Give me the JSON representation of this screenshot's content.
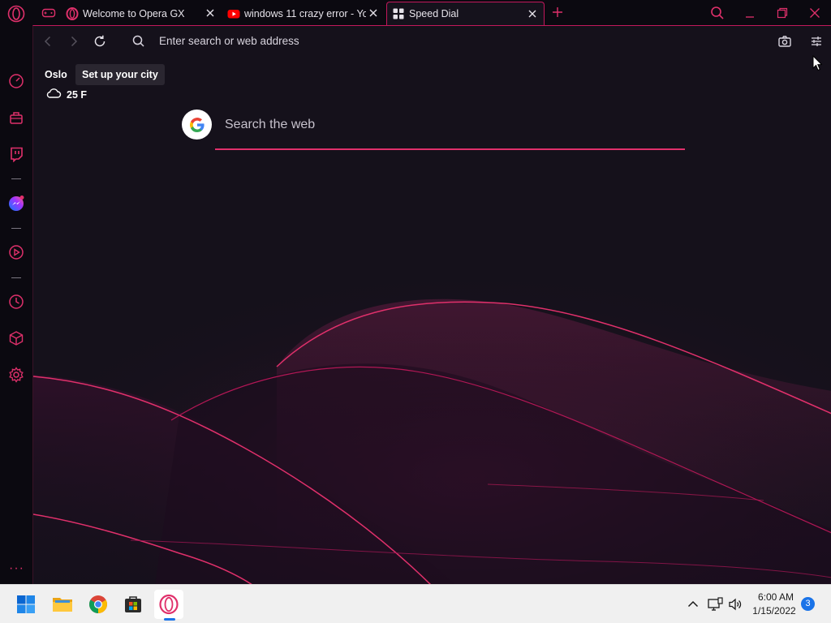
{
  "browser": {
    "tabs": [
      {
        "title": "Welcome to Opera GX",
        "favicon": "opera-icon",
        "active": false
      },
      {
        "title": "windows 11 crazy error - Yo",
        "favicon": "youtube-icon",
        "active": false
      },
      {
        "title": "Speed Dial",
        "favicon": "speed-dial-grid-icon",
        "active": true
      }
    ],
    "address_bar": {
      "placeholder": "Enter search or web address"
    }
  },
  "weather": {
    "city": "Oslo",
    "tooltip": "Set up your city",
    "temperature": "25 F",
    "icon": "cloud-icon"
  },
  "search": {
    "placeholder": "Search the web",
    "engine_icon": "google-icon"
  },
  "sidebar": {
    "items": [
      "speedometer-icon",
      "bag-icon",
      "twitch-icon",
      "messenger-icon",
      "player-icon",
      "history-icon",
      "cube-icon",
      "settings-icon"
    ],
    "more": "···"
  },
  "taskbar": {
    "apps": [
      "windows-start-icon",
      "file-explorer-icon",
      "chrome-icon",
      "store-icon",
      "opera-gx-icon"
    ],
    "tray": [
      "chevron-up-icon",
      "network-icon",
      "volume-icon"
    ],
    "time": "6:00 AM",
    "date": "1/15/2022",
    "notifications": "3"
  },
  "colors": {
    "accent": "#e0306b",
    "background": "#15111b",
    "taskbar": "#f0f0f0"
  }
}
